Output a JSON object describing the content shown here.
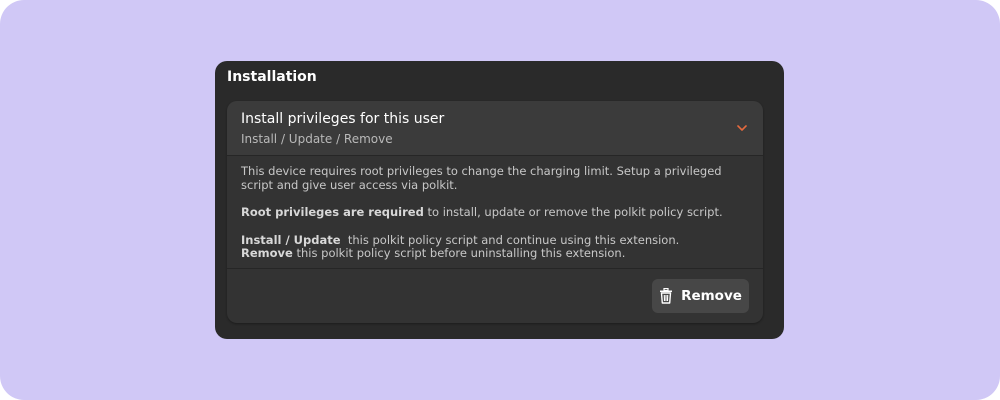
{
  "group": {
    "title": "Installation"
  },
  "expander": {
    "title": "Install privileges for this user",
    "subtitle": "Install / Update / Remove",
    "accent_color": "#e66a3e"
  },
  "description": {
    "intro": "This device requires root privileges to change the charging limit. Setup a privileged script and give user access via polkit.",
    "required_bold": "Root privileges are required",
    "required_rest": " to install, update or remove the polkit policy script.",
    "install_bold": "Install / Update",
    "install_rest": "  this polkit policy script and continue using this extension.",
    "remove_bold": "Remove",
    "remove_rest": " this polkit policy script before uninstalling this extension."
  },
  "actions": {
    "remove_label": "Remove",
    "remove_icon": "trash-icon"
  },
  "colors": {
    "backdrop": "#d0c8f6",
    "window": "#2a2a2a",
    "card": "#333333",
    "row": "#3b3b3b",
    "button": "#474747"
  }
}
